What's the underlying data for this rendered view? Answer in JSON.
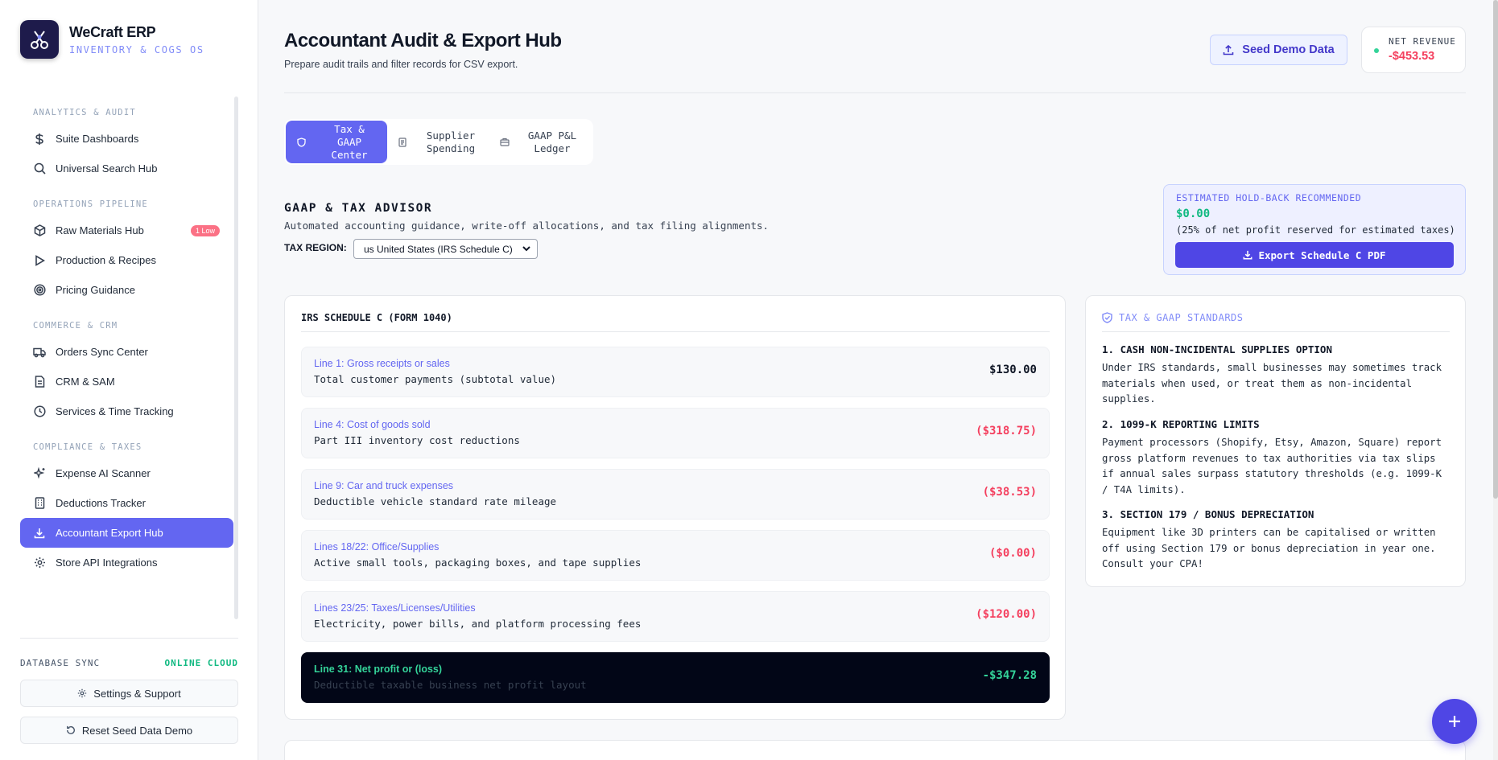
{
  "brand": {
    "title": "WeCraft ERP",
    "subtitle": "INVENTORY & COGS OS"
  },
  "sidebar": {
    "sections": [
      {
        "title": "ANALYTICS & AUDIT",
        "items": [
          {
            "label": "Suite Dashboards",
            "icon": "dollar-icon"
          },
          {
            "label": "Universal Search Hub",
            "icon": "search-icon"
          }
        ]
      },
      {
        "title": "OPERATIONS PIPELINE",
        "items": [
          {
            "label": "Raw Materials Hub",
            "icon": "box-icon",
            "badge": "1 Low"
          },
          {
            "label": "Production & Recipes",
            "icon": "play-icon"
          },
          {
            "label": "Pricing Guidance",
            "icon": "target-icon"
          }
        ]
      },
      {
        "title": "COMMERCE & CRM",
        "items": [
          {
            "label": "Orders Sync Center",
            "icon": "truck-icon"
          },
          {
            "label": "CRM & SAM",
            "icon": "document-icon"
          },
          {
            "label": "Services & Time Tracking",
            "icon": "clock-icon"
          }
        ]
      },
      {
        "title": "COMPLIANCE & TAXES",
        "items": [
          {
            "label": "Expense AI Scanner",
            "icon": "sparkle-icon"
          },
          {
            "label": "Deductions Tracker",
            "icon": "building-icon"
          },
          {
            "label": "Accountant Export Hub",
            "icon": "download-icon",
            "active": true
          },
          {
            "label": "Store API Integrations",
            "icon": "gear-icon"
          }
        ]
      }
    ],
    "db_sync_label": "DATABASE SYNC",
    "db_sync_status": "ONLINE CLOUD",
    "settings_button": "Settings & Support",
    "reset_button": "Reset Seed Data Demo"
  },
  "header": {
    "title": "Accountant Audit & Export Hub",
    "subtitle": "Prepare audit trails and filter records for CSV export.",
    "seed_button": "Seed Demo Data",
    "net_revenue_label": "NET REVENUE",
    "net_revenue_value": "-$453.53"
  },
  "tabs": [
    {
      "label": "Tax & GAAP Center",
      "icon": "shield-icon",
      "active": true
    },
    {
      "label": "Supplier Spending",
      "icon": "receipt-icon"
    },
    {
      "label": "GAAP P&L Ledger",
      "icon": "briefcase-icon"
    }
  ],
  "advisor": {
    "title": "GAAP & TAX ADVISOR",
    "subtitle": "Automated accounting guidance, write-off allocations, and tax filing alignments.",
    "region_label": "TAX REGION:",
    "region_value": "us United States (IRS Schedule C)"
  },
  "holdback": {
    "title": "ESTIMATED HOLD-BACK RECOMMENDED",
    "value": "$0.00",
    "note": "(25% of net profit reserved for estimated taxes)",
    "button": "Export Schedule C PDF"
  },
  "schedule": {
    "title": "IRS SCHEDULE C (FORM 1040)",
    "lines": [
      {
        "title": "Line 1: Gross receipts or sales",
        "desc": "Total customer payments (subtotal value)",
        "value": "$130.00",
        "kind": "pos"
      },
      {
        "title": "Line 4: Cost of goods sold",
        "desc": "Part III inventory cost reductions",
        "value": "($318.75)",
        "kind": "neg"
      },
      {
        "title": "Line 9: Car and truck expenses",
        "desc": "Deductible vehicle standard rate mileage",
        "value": "($38.53)",
        "kind": "neg"
      },
      {
        "title": "Lines 18/22: Office/Supplies",
        "desc": "Active small tools, packaging boxes, and tape supplies",
        "value": "($0.00)",
        "kind": "neg"
      },
      {
        "title": "Lines 23/25: Taxes/Licenses/Utilities",
        "desc": "Electricity, power bills, and platform processing fees",
        "value": "($120.00)",
        "kind": "neg"
      },
      {
        "title": "Line 31: Net profit or (loss)",
        "desc": "Deductible taxable business net profit layout",
        "value": "-$347.28",
        "kind": "net"
      }
    ]
  },
  "standards": {
    "title": "TAX & GAAP STANDARDS",
    "items": [
      {
        "heading": "1. CASH NON-INCIDENTAL SUPPLIES OPTION",
        "body": "Under IRS standards, small businesses may sometimes track materials when used, or treat them as non-incidental supplies."
      },
      {
        "heading": "2. 1099-K REPORTING LIMITS",
        "body": "Payment processors (Shopify, Etsy, Amazon, Square) report gross platform revenues to tax authorities via tax slips if annual sales surpass statutory thresholds (e.g. 1099-K / T4A limits)."
      },
      {
        "heading": "3. SECTION 179 / BONUS DEPRECIATION",
        "body": "Equipment like 3D printers can be capitalised or written off using Section 179 or bonus depreciation in year one. Consult your CPA!"
      }
    ]
  },
  "colors": {
    "accent": "#6366f1",
    "danger": "#f43f5e",
    "success": "#10b981"
  }
}
